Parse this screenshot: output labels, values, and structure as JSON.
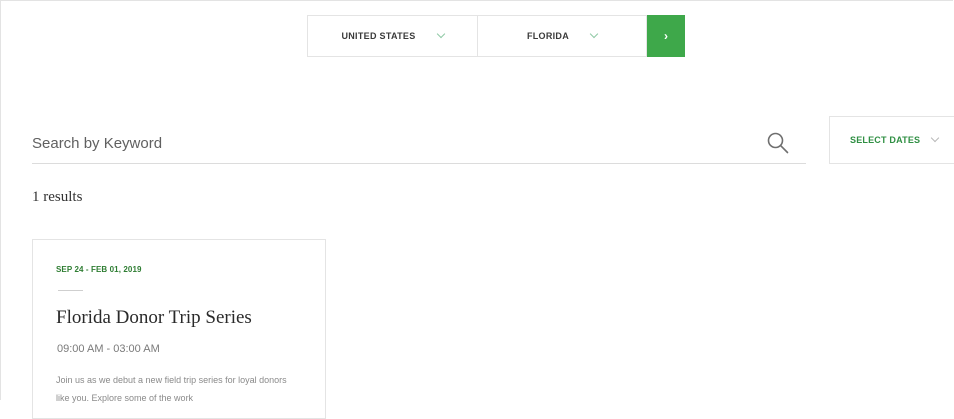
{
  "location": {
    "country_label": "UNITED STATES",
    "state_label": "FLORIDA",
    "go_symbol": "›"
  },
  "search": {
    "placeholder": "Search by Keyword",
    "value": ""
  },
  "dates": {
    "label": "SELECT DATES"
  },
  "results": {
    "count_text": "1 results"
  },
  "events": [
    {
      "date_range": "SEP 24 - FEB 01, 2019",
      "title": "Florida Donor Trip Series",
      "time": "09:00 AM - 03:00 AM",
      "description": "Join us as we debut a new field trip series for loyal donors like you. Explore some of the work"
    }
  ],
  "colors": {
    "accent_green": "#3ea84a",
    "date_green": "#2e7d32",
    "border": "#e4e4e4"
  },
  "icons": {
    "search": "search-icon",
    "chevron": "chevron-down-icon",
    "arrow": "chevron-right-icon"
  }
}
